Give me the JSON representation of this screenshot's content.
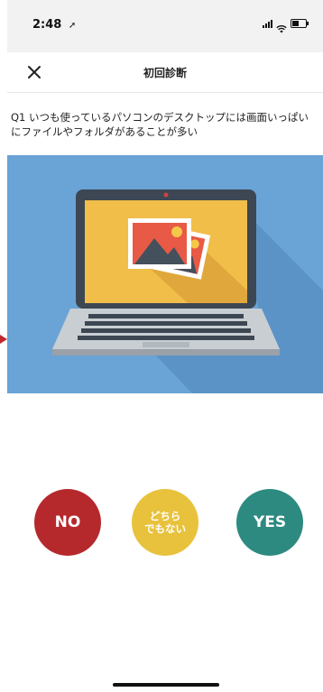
{
  "status_bar": {
    "time": "2:48",
    "location_icon": "location-arrow-icon",
    "signal_icon": "signal-icon",
    "wifi_icon": "wifi-icon",
    "battery_icon": "battery-icon"
  },
  "header": {
    "close_icon": "close-icon",
    "title": "初回診断"
  },
  "question": {
    "text": "Q1 いつも使っているパソコンのデスクトップには画面いっぱいにファイルやフォルダがあることが多い"
  },
  "illustration": {
    "icon": "laptop-with-photos-icon",
    "background": "#6aa3d6"
  },
  "answers": {
    "no_label": "NO",
    "neutral_line1": "どちら",
    "neutral_line2": "でもない",
    "yes_label": "YES",
    "colors": {
      "no": "#b5292d",
      "neutral": "#e8c23d",
      "yes": "#2d8a80"
    }
  }
}
